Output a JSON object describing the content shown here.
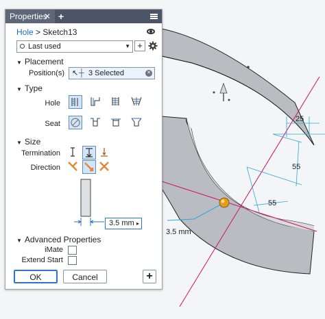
{
  "panel": {
    "tab_title": "Properties",
    "tab_close": "✕",
    "add_tab": "+",
    "breadcrumb": {
      "feature": "Hole",
      "separator": ">",
      "sketch": "Sketch13"
    },
    "preset": {
      "value": "Last used",
      "add": "+"
    },
    "placement": {
      "header": "Placement",
      "positions_label": "Position(s)",
      "positions_value": "3 Selected"
    },
    "type": {
      "header": "Type",
      "hole_label": "Hole",
      "seat_label": "Seat"
    },
    "size": {
      "header": "Size",
      "termination_label": "Termination",
      "direction_label": "Direction",
      "diameter_value": "3.5 mm",
      "diameter_arrow": "▸"
    },
    "advanced": {
      "header": "Advanced Properties",
      "imate_label": "iMate",
      "extend_start_label": "Extend Start"
    },
    "buttons": {
      "ok": "OK",
      "cancel": "Cancel",
      "add": "+"
    }
  },
  "viewport": {
    "dimension_25": "25",
    "dimension_55_upper": "55",
    "dimension_55_lower": "55",
    "hole_diameter_label": "3.5 mm"
  },
  "colors": {
    "accent_blue": "#1a6fc4",
    "titlebar": "#4b5565",
    "selection_fill": "#d3e5f7",
    "construction_line": "#d0106e",
    "dimension_line": "#2da8d8",
    "part_gray": "#b9bcc0",
    "hole_orange": "#e39b1c"
  }
}
